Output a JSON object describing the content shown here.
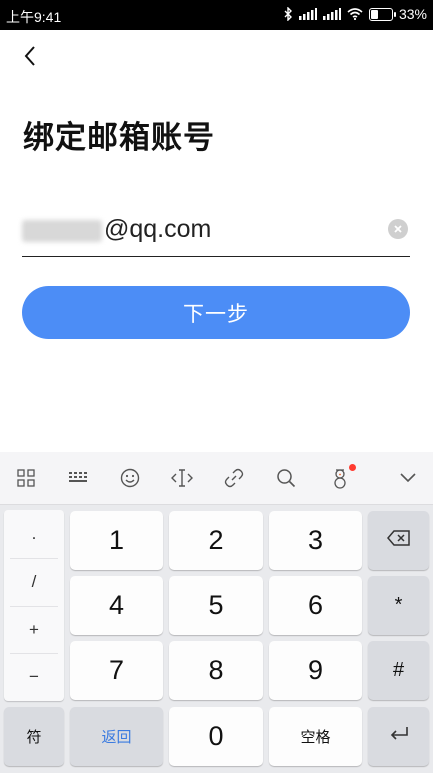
{
  "status_bar": {
    "time": "上午9:41",
    "battery_percent": "33%",
    "battery_level": 0.33,
    "icons": [
      "bluetooth-icon",
      "signal-icon",
      "signal-icon",
      "wifi-icon",
      "battery-icon"
    ]
  },
  "header": {
    "back_icon": "chevron-left-icon",
    "title": "绑定邮箱账号"
  },
  "email_field": {
    "value_suffix": "@qq.com",
    "clear_icon": "clear-icon"
  },
  "next_button": {
    "label": "下一步"
  },
  "colors": {
    "primary": "#4c8df6",
    "keyboard_bg": "#e9eaed",
    "return_key_text": "#3b7be0",
    "notification_dot": "#ff3b30"
  },
  "keyboard": {
    "toolbar_icons": [
      "grid-icon",
      "keyboard-icon",
      "emoji-icon",
      "cursor-icon",
      "link-icon",
      "search-icon",
      "snowman-icon",
      "chevron-down-icon"
    ],
    "symbols": [
      ".",
      "/",
      "+",
      "−"
    ],
    "digits": [
      "1",
      "2",
      "3",
      "4",
      "5",
      "6",
      "7",
      "8",
      "9"
    ],
    "zero": "0",
    "side_keys": {
      "backspace_icon": "backspace-icon",
      "asterisk": "*",
      "hash": "#",
      "enter_icon": "enter-icon"
    },
    "bottom": {
      "symbols": "符",
      "return": "返回",
      "space": "空格"
    }
  }
}
